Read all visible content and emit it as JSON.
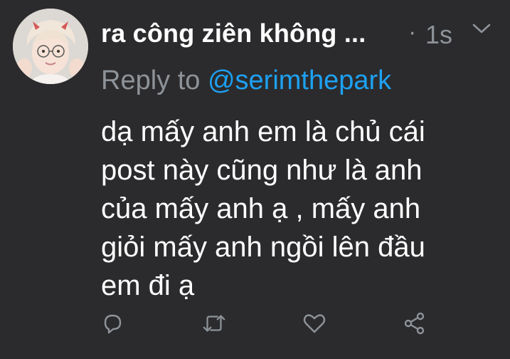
{
  "tweet": {
    "display_name": "ra công ziên không ...",
    "separator": "·",
    "timestamp": "1s",
    "reply_prefix": "Replying to",
    "reply_prefix_shown": "Reply to ",
    "reply_handle": "@serimthepark",
    "body_lines": [
      "dạ mấy anh em là chủ cái",
      "post này cũng như là anh",
      "của mấy anh ạ , mấy anh",
      "giỏi mấy anh ngồi lên đầu",
      "em đi ạ"
    ]
  },
  "actions": [
    {
      "icon": "reply-icon"
    },
    {
      "icon": "retweet-icon"
    },
    {
      "icon": "like-icon"
    },
    {
      "icon": "share-icon"
    }
  ],
  "colors": {
    "background": "#2b2b2d",
    "text": "#ffffff",
    "muted": "#8e9399",
    "accent": "#1da1f2"
  }
}
